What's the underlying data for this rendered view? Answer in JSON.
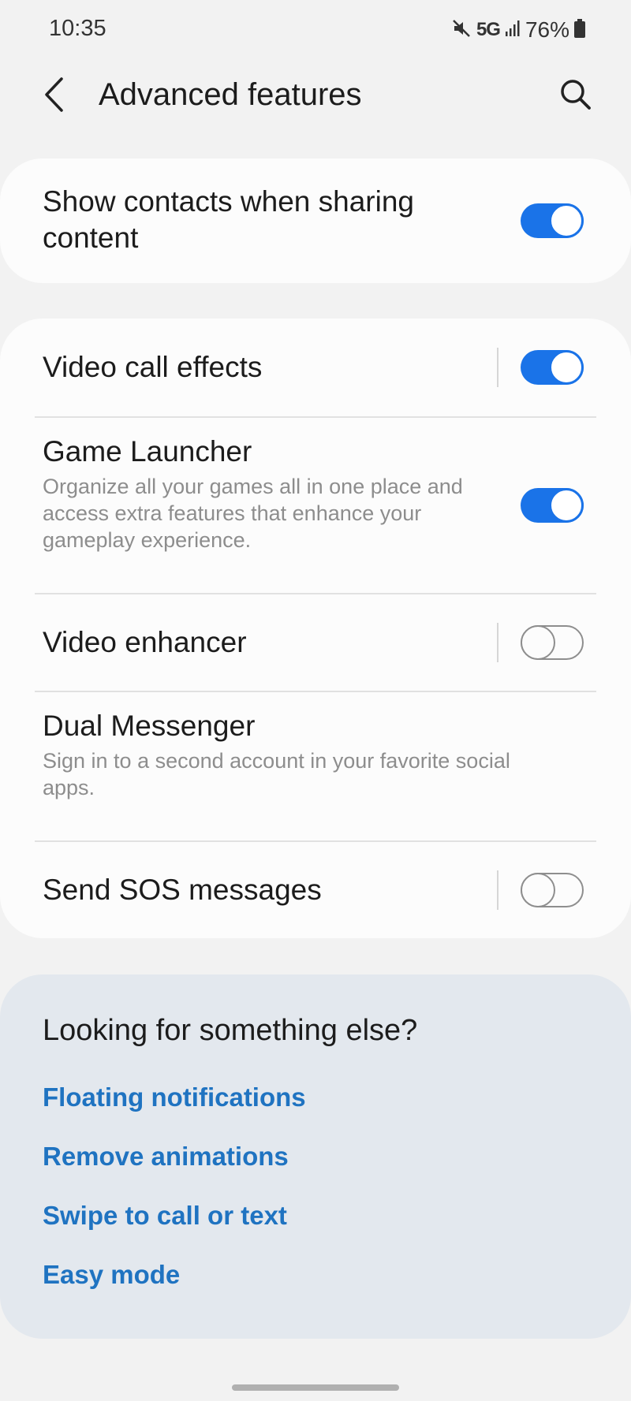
{
  "status_bar": {
    "time": "10:35",
    "network": "5G",
    "battery": "76%",
    "icons": [
      "mute-icon",
      "signal-icon",
      "battery-icon"
    ]
  },
  "header": {
    "title": "Advanced features",
    "back_icon": "back-arrow-icon",
    "search_icon": "search-icon"
  },
  "settings": [
    {
      "title": "Show contacts when sharing content",
      "description": "",
      "toggle": true
    },
    {
      "title": "Video call effects",
      "description": "",
      "toggle": true
    },
    {
      "title": "Game Launcher",
      "description": "Organize all your games all in one place and access extra features that enhance your gameplay experience.",
      "toggle": true
    },
    {
      "title": "Video enhancer",
      "description": "",
      "toggle": false
    },
    {
      "title": "Dual Messenger",
      "description": "Sign in to a second account in your favorite social apps.",
      "toggle": null
    },
    {
      "title": "Send SOS messages",
      "description": "",
      "toggle": false
    }
  ],
  "suggestions": {
    "title": "Looking for something else?",
    "links": [
      "Floating notifications",
      "Remove animations",
      "Swipe to call or text",
      "Easy mode"
    ]
  },
  "colors": {
    "accent": "#1a73e8",
    "link": "#1f73c1",
    "background": "#f2f2f2",
    "card": "#fcfcfc",
    "suggest_card": "#e3e8ee"
  }
}
